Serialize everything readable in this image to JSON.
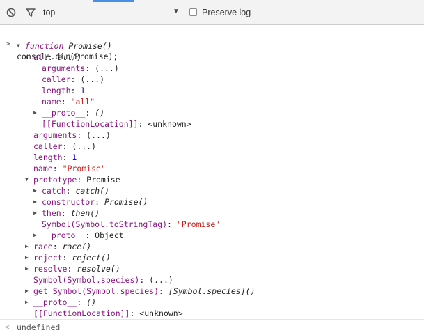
{
  "toolbar": {
    "clear_icon": "block-icon",
    "filter_icon": "filter-icon",
    "context": "top",
    "dropdown_glyph": "▼",
    "preserve_log_label": "Preserve log"
  },
  "console": {
    "prompt_glyph": ">",
    "command": "console.dir(Promise);",
    "tree": [
      {
        "indent": 0,
        "arrow": "down",
        "parts": [
          {
            "t": "function ",
            "c": "fnkw"
          },
          {
            "t": "Promise()",
            "c": "it"
          }
        ]
      },
      {
        "indent": 1,
        "arrow": "down",
        "parts": [
          {
            "t": "all",
            "c": "k"
          },
          {
            "t": ": "
          },
          {
            "t": "all()",
            "c": "it"
          }
        ]
      },
      {
        "indent": 2,
        "arrow": "none",
        "parts": [
          {
            "t": "arguments",
            "c": "k"
          },
          {
            "t": ": (...)"
          }
        ]
      },
      {
        "indent": 2,
        "arrow": "none",
        "parts": [
          {
            "t": "caller",
            "c": "k"
          },
          {
            "t": ": (...)"
          }
        ]
      },
      {
        "indent": 2,
        "arrow": "none",
        "parts": [
          {
            "t": "length",
            "c": "k"
          },
          {
            "t": ": "
          },
          {
            "t": "1",
            "c": "num"
          }
        ]
      },
      {
        "indent": 2,
        "arrow": "none",
        "parts": [
          {
            "t": "name",
            "c": "k"
          },
          {
            "t": ": "
          },
          {
            "t": "\"all\"",
            "c": "str"
          }
        ]
      },
      {
        "indent": 2,
        "arrow": "right",
        "parts": [
          {
            "t": "__proto__",
            "c": "k"
          },
          {
            "t": ": "
          },
          {
            "t": "()",
            "c": "it"
          }
        ]
      },
      {
        "indent": 2,
        "arrow": "none",
        "parts": [
          {
            "t": "[[FunctionLocation]]",
            "c": "k"
          },
          {
            "t": ": <unknown>"
          }
        ]
      },
      {
        "indent": 1,
        "arrow": "none",
        "parts": [
          {
            "t": "arguments",
            "c": "k"
          },
          {
            "t": ": (...)"
          }
        ]
      },
      {
        "indent": 1,
        "arrow": "none",
        "parts": [
          {
            "t": "caller",
            "c": "k"
          },
          {
            "t": ": (...)"
          }
        ]
      },
      {
        "indent": 1,
        "arrow": "none",
        "parts": [
          {
            "t": "length",
            "c": "k"
          },
          {
            "t": ": "
          },
          {
            "t": "1",
            "c": "num"
          }
        ]
      },
      {
        "indent": 1,
        "arrow": "none",
        "parts": [
          {
            "t": "name",
            "c": "k"
          },
          {
            "t": ": "
          },
          {
            "t": "\"Promise\"",
            "c": "str"
          }
        ]
      },
      {
        "indent": 1,
        "arrow": "down",
        "parts": [
          {
            "t": "prototype",
            "c": "k"
          },
          {
            "t": ": Promise"
          }
        ]
      },
      {
        "indent": 2,
        "arrow": "right",
        "parts": [
          {
            "t": "catch",
            "c": "k"
          },
          {
            "t": ": "
          },
          {
            "t": "catch()",
            "c": "it"
          }
        ]
      },
      {
        "indent": 2,
        "arrow": "right",
        "parts": [
          {
            "t": "constructor",
            "c": "k"
          },
          {
            "t": ": "
          },
          {
            "t": "Promise()",
            "c": "it"
          }
        ]
      },
      {
        "indent": 2,
        "arrow": "right",
        "parts": [
          {
            "t": "then",
            "c": "k"
          },
          {
            "t": ": "
          },
          {
            "t": "then()",
            "c": "it"
          }
        ]
      },
      {
        "indent": 2,
        "arrow": "none",
        "parts": [
          {
            "t": "Symbol(Symbol.toStringTag)",
            "c": "k"
          },
          {
            "t": ": "
          },
          {
            "t": "\"Promise\"",
            "c": "str"
          }
        ]
      },
      {
        "indent": 2,
        "arrow": "right",
        "parts": [
          {
            "t": "__proto__",
            "c": "k"
          },
          {
            "t": ": Object"
          }
        ]
      },
      {
        "indent": 1,
        "arrow": "right",
        "parts": [
          {
            "t": "race",
            "c": "k"
          },
          {
            "t": ": "
          },
          {
            "t": "race()",
            "c": "it"
          }
        ]
      },
      {
        "indent": 1,
        "arrow": "right",
        "parts": [
          {
            "t": "reject",
            "c": "k"
          },
          {
            "t": ": "
          },
          {
            "t": "reject()",
            "c": "it"
          }
        ]
      },
      {
        "indent": 1,
        "arrow": "right",
        "parts": [
          {
            "t": "resolve",
            "c": "k"
          },
          {
            "t": ": "
          },
          {
            "t": "resolve()",
            "c": "it"
          }
        ]
      },
      {
        "indent": 1,
        "arrow": "none",
        "parts": [
          {
            "t": "Symbol(Symbol.species)",
            "c": "k"
          },
          {
            "t": ": (...)"
          }
        ]
      },
      {
        "indent": 1,
        "arrow": "right",
        "parts": [
          {
            "t": "get Symbol(Symbol.species)",
            "c": "k"
          },
          {
            "t": ": "
          },
          {
            "t": "[Symbol.species]()",
            "c": "it"
          }
        ]
      },
      {
        "indent": 1,
        "arrow": "right",
        "parts": [
          {
            "t": "__proto__",
            "c": "k"
          },
          {
            "t": ": "
          },
          {
            "t": "()",
            "c": "it"
          }
        ]
      },
      {
        "indent": 1,
        "arrow": "none",
        "parts": [
          {
            "t": "[[FunctionLocation]]",
            "c": "k"
          },
          {
            "t": ": <unknown>"
          }
        ]
      }
    ],
    "result_glyph": "<",
    "result": "undefined"
  },
  "colors": {
    "key": "#881280",
    "string": "#c41a16",
    "number": "#1c00cf",
    "accent": "#4a8ee6"
  }
}
